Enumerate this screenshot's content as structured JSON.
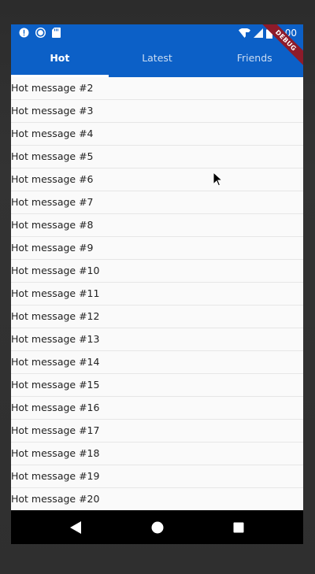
{
  "status_bar": {
    "time": "1:00",
    "left_icons": [
      "alert-icon",
      "record-icon",
      "sd-card-icon"
    ],
    "right_icons": [
      "wifi-icon",
      "signal-icon",
      "battery-icon"
    ]
  },
  "debug_banner": "DEBUG",
  "tabs": [
    {
      "label": "Hot",
      "active": true
    },
    {
      "label": "Latest",
      "active": false
    },
    {
      "label": "Friends",
      "active": false
    }
  ],
  "list": {
    "items": [
      "Hot message #2",
      "Hot message #3",
      "Hot message #4",
      "Hot message #5",
      "Hot message #6",
      "Hot message #7",
      "Hot message #8",
      "Hot message #9",
      "Hot message #10",
      "Hot message #11",
      "Hot message #12",
      "Hot message #13",
      "Hot message #14",
      "Hot message #15",
      "Hot message #16",
      "Hot message #17",
      "Hot message #18",
      "Hot message #19",
      "Hot message #20"
    ]
  },
  "nav_bar": {
    "buttons": [
      "back-icon",
      "home-icon",
      "recents-icon"
    ]
  },
  "colors": {
    "primary": "#0c60c7",
    "ribbon": "#8e1b2a",
    "background": "#fafafa"
  }
}
